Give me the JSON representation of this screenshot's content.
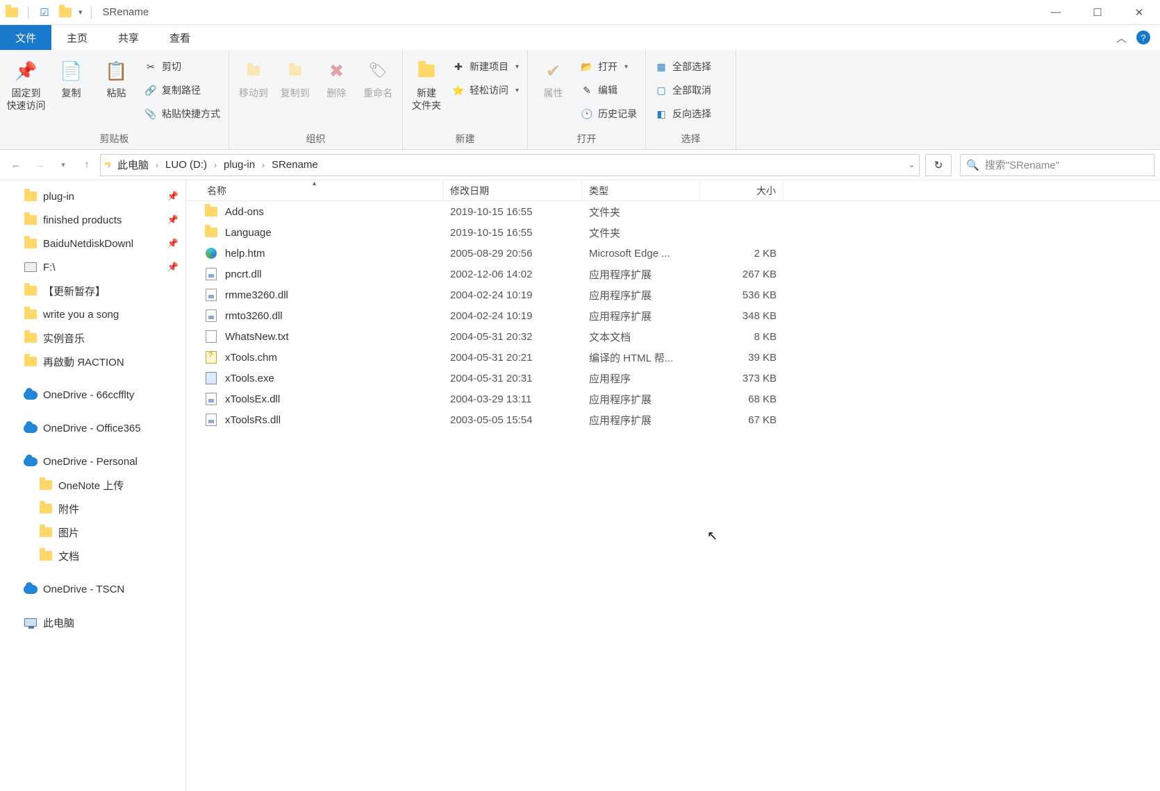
{
  "window": {
    "title": "SRename",
    "min": "—",
    "max": "☐",
    "close": "✕"
  },
  "tabs": {
    "file": "文件",
    "home": "主页",
    "share": "共享",
    "view": "查看"
  },
  "ribbon": {
    "clipboard": {
      "label": "剪贴板",
      "pin": "固定到\n快速访问",
      "copy": "复制",
      "paste": "粘贴",
      "cut": "剪切",
      "copypath": "复制路径",
      "pasteshortcut": "粘贴快捷方式"
    },
    "organize": {
      "label": "组织",
      "moveto": "移动到",
      "copyto": "复制到",
      "delete": "删除",
      "rename": "重命名"
    },
    "new": {
      "label": "新建",
      "newfolder": "新建\n文件夹",
      "newitem": "新建项目",
      "easyaccess": "轻松访问"
    },
    "open": {
      "label": "打开",
      "properties": "属性",
      "open": "打开",
      "edit": "编辑",
      "history": "历史记录"
    },
    "select": {
      "label": "选择",
      "all": "全部选择",
      "none": "全部取消",
      "invert": "反向选择"
    }
  },
  "breadcrumb": [
    "此电脑",
    "LUO (D:)",
    "plug-in",
    "SRename"
  ],
  "search_placeholder": "搜索\"SRename\"",
  "columns": {
    "name": "名称",
    "date": "修改日期",
    "type": "类型",
    "size": "大小"
  },
  "sidebar": [
    {
      "icon": "folder",
      "label": "plug-in",
      "pin": true
    },
    {
      "icon": "folder",
      "label": "finished products",
      "pin": true
    },
    {
      "icon": "folder",
      "label": "BaiduNetdiskDownl",
      "pin": true
    },
    {
      "icon": "disk",
      "label": "F:\\",
      "pin": true
    },
    {
      "icon": "folder",
      "label": "【更新暂存】",
      "indent": false
    },
    {
      "icon": "folder",
      "label": "write you a song"
    },
    {
      "icon": "folder",
      "label": "实例音乐"
    },
    {
      "icon": "folder",
      "label": "再啟動 ЯACTION"
    },
    {
      "sep": true
    },
    {
      "icon": "onedrive",
      "label": "OneDrive - 66ccfflty"
    },
    {
      "sep": true
    },
    {
      "icon": "onedrive",
      "label": "OneDrive - Office365"
    },
    {
      "sep": true
    },
    {
      "icon": "onedrive",
      "label": "OneDrive - Personal"
    },
    {
      "icon": "folder",
      "label": "OneNote 上传",
      "indent": true
    },
    {
      "icon": "folder",
      "label": "附件",
      "indent": true
    },
    {
      "icon": "folder",
      "label": "图片",
      "indent": true
    },
    {
      "icon": "folder",
      "label": "文档",
      "indent": true
    },
    {
      "sep": true
    },
    {
      "icon": "onedrive",
      "label": "OneDrive - TSCN"
    },
    {
      "sep": true
    },
    {
      "icon": "pc",
      "label": "此电脑"
    }
  ],
  "files": [
    {
      "icon": "folder",
      "name": "Add-ons",
      "date": "2019-10-15 16:55",
      "type": "文件夹",
      "size": ""
    },
    {
      "icon": "folder",
      "name": "Language",
      "date": "2019-10-15 16:55",
      "type": "文件夹",
      "size": ""
    },
    {
      "icon": "edge",
      "name": "help.htm",
      "date": "2005-08-29 20:56",
      "type": "Microsoft Edge ...",
      "size": "2 KB"
    },
    {
      "icon": "dll",
      "name": "pncrt.dll",
      "date": "2002-12-06 14:02",
      "type": "应用程序扩展",
      "size": "267 KB"
    },
    {
      "icon": "dll",
      "name": "rmme3260.dll",
      "date": "2004-02-24 10:19",
      "type": "应用程序扩展",
      "size": "536 KB"
    },
    {
      "icon": "dll",
      "name": "rmto3260.dll",
      "date": "2004-02-24 10:19",
      "type": "应用程序扩展",
      "size": "348 KB"
    },
    {
      "icon": "file",
      "name": "WhatsNew.txt",
      "date": "2004-05-31 20:32",
      "type": "文本文档",
      "size": "8 KB"
    },
    {
      "icon": "chm",
      "name": "xTools.chm",
      "date": "2004-05-31 20:21",
      "type": "编译的 HTML 帮...",
      "size": "39 KB"
    },
    {
      "icon": "exe",
      "name": "xTools.exe",
      "date": "2004-05-31 20:31",
      "type": "应用程序",
      "size": "373 KB"
    },
    {
      "icon": "dll",
      "name": "xToolsEx.dll",
      "date": "2004-03-29 13:11",
      "type": "应用程序扩展",
      "size": "68 KB"
    },
    {
      "icon": "dll",
      "name": "xToolsRs.dll",
      "date": "2003-05-05 15:54",
      "type": "应用程序扩展",
      "size": "67 KB"
    }
  ]
}
